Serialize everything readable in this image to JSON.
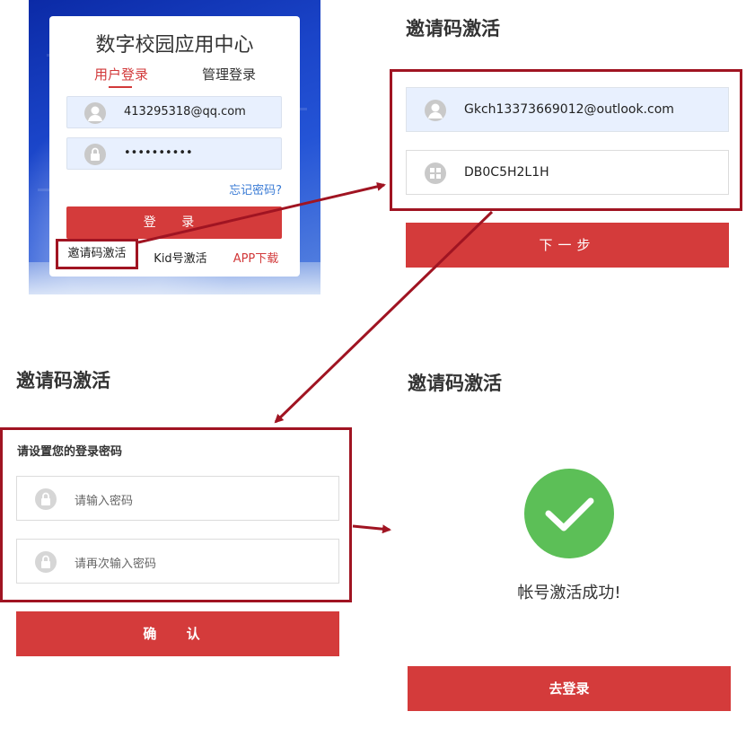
{
  "login": {
    "title": "数字校园应用中心",
    "tab_user": "用户登录",
    "tab_admin": "管理登录",
    "username_value": "413295318@qq.com",
    "password_value": "••••••••••",
    "forgot_link": "忘记密码?",
    "login_button": "登 录",
    "invite_link": "邀请码激活",
    "kid_link": "Kid号激活",
    "app_link": "APP下载"
  },
  "invite_step1": {
    "heading": "邀请码激活",
    "account_value": "Gkch13373669012@outlook.com",
    "code_value": "DB0C5H2L1H",
    "next_button": "下一步"
  },
  "invite_step2": {
    "heading": "邀请码激活",
    "subtitle": "请设置您的登录密码",
    "password_placeholder": "请输入密码",
    "confirm_placeholder": "请再次输入密码",
    "confirm_button": "确 认"
  },
  "invite_step3": {
    "heading": "邀请码激活",
    "success_message": "帐号激活成功!",
    "login_button": "去登录"
  },
  "colors": {
    "primary_red": "#d43b3b",
    "highlight_border": "#a01422",
    "success_green": "#5cbf57",
    "link_blue": "#3a7bd5"
  }
}
